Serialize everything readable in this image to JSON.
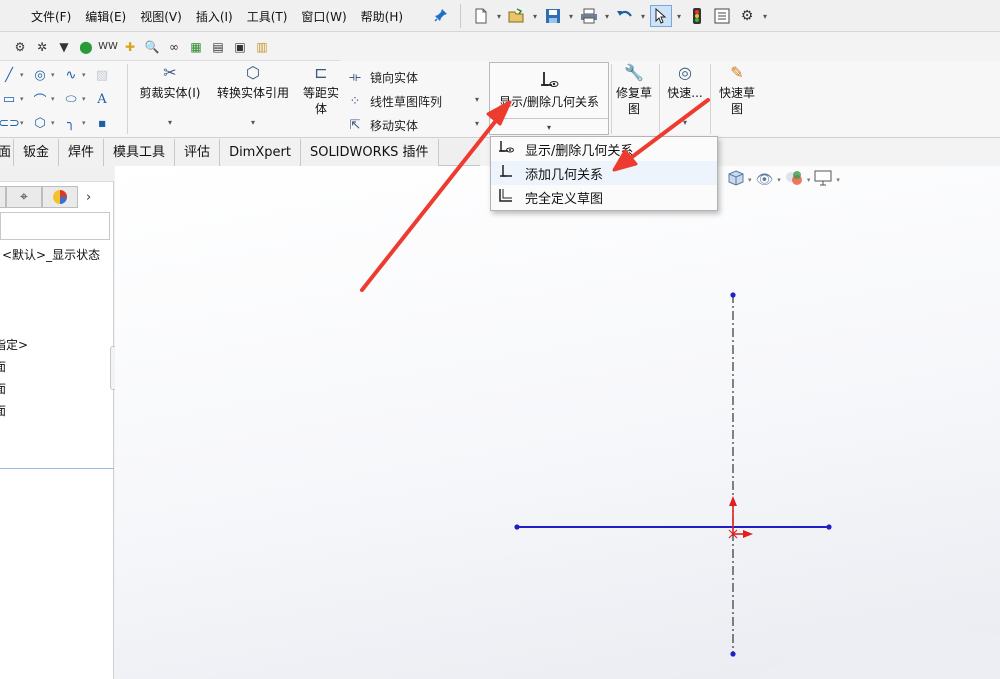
{
  "menu": {
    "file": "文件(F)",
    "edit": "编辑(E)",
    "view": "视图(V)",
    "insert": "插入(I)",
    "tools": "工具(T)",
    "window": "窗口(W)",
    "help": "帮助(H)"
  },
  "ribbon": {
    "trim": "剪裁实体(I)",
    "convert": "转换实体引用",
    "offset_1": "等距实",
    "offset_2": "体",
    "mirror": "镜向实体",
    "linear_pattern": "线性草图阵列",
    "move": "移动实体",
    "relations": "显示/删除几何关系",
    "repair_1": "修复草",
    "repair_2": "图",
    "quick_snaps": "快速...",
    "rapid_1": "快速草",
    "rapid_2": "图"
  },
  "tabs": [
    "面",
    "钣金",
    "焊件",
    "模具工具",
    "评估",
    "DimXpert",
    "SOLIDWORKS 插件"
  ],
  "left_panel": {
    "config": "<默认>_显示状态",
    "unresolved": "指定>",
    "planes": [
      "面",
      "面",
      "面"
    ]
  },
  "relations_dropdown": {
    "items": [
      "显示/删除几何关系",
      "添加几何关系",
      "完全定义草图"
    ]
  },
  "colors": {
    "sketch_line": "#1f1fc8",
    "centerline": "#333333",
    "origin": "#e02020",
    "arrow": "#ee3b2f"
  },
  "icons": {
    "pin": "pin-icon",
    "select": "select-arrow-icon",
    "traffic": "rebuild-light-icon"
  }
}
